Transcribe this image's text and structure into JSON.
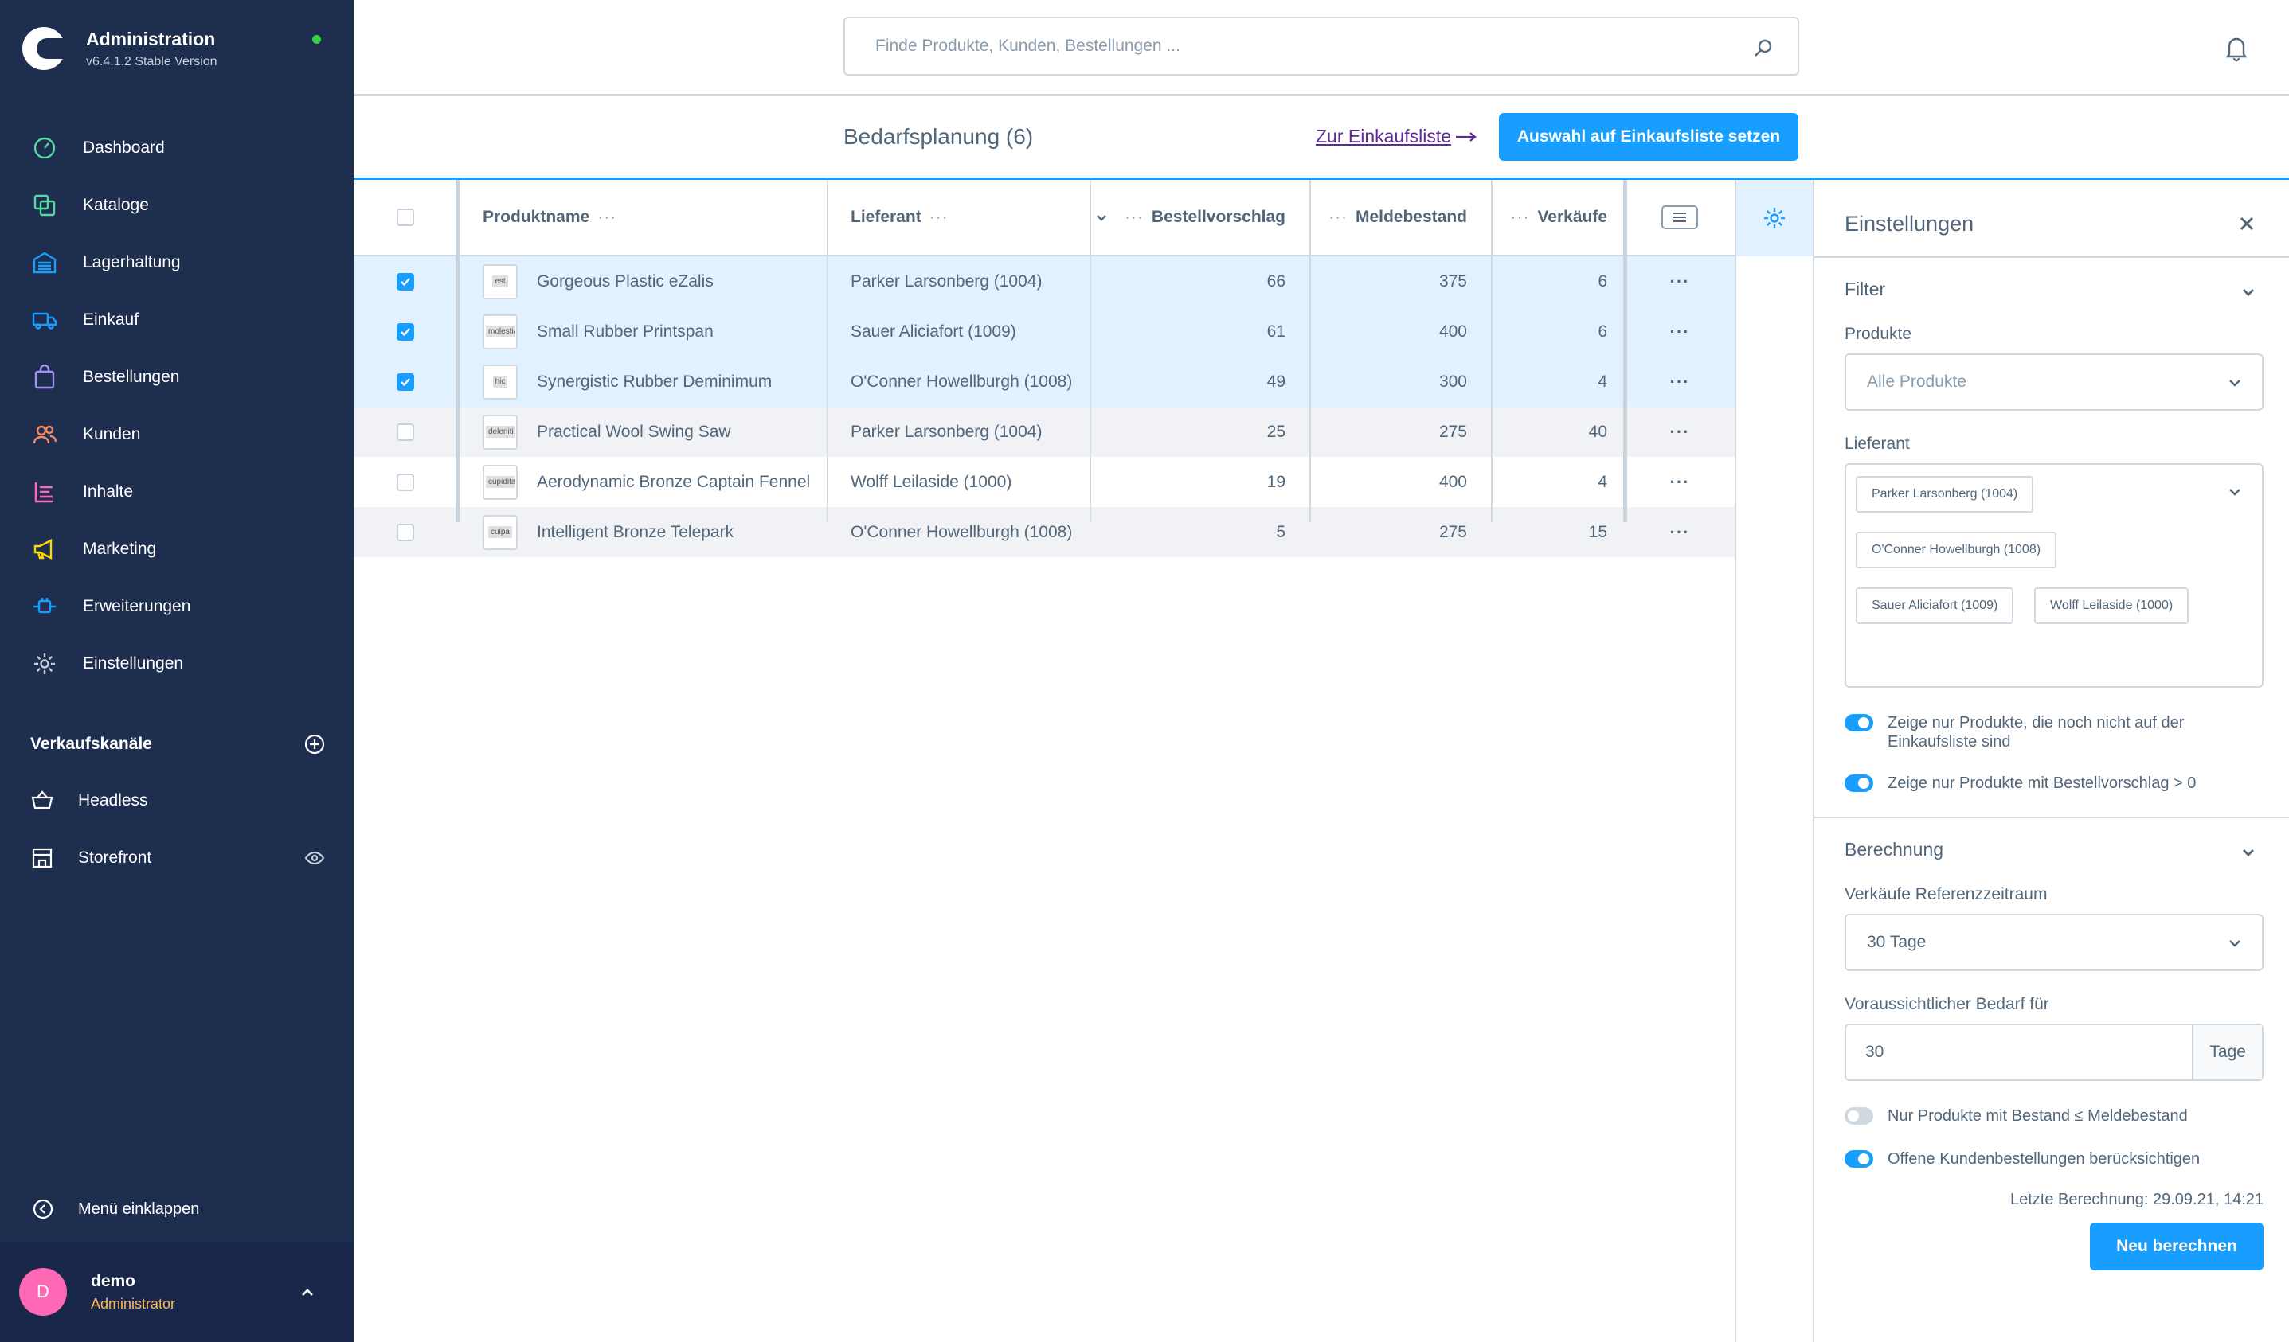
{
  "app": {
    "title": "Administration",
    "version": "v6.4.1.2 Stable Version"
  },
  "nav": [
    {
      "id": "dashboard",
      "label": "Dashboard",
      "icon": "dashboard-icon",
      "color": "#57d9a3"
    },
    {
      "id": "kataloge",
      "label": "Kataloge",
      "icon": "catalog-icon",
      "color": "#57d9a3"
    },
    {
      "id": "lagerhaltung",
      "label": "Lagerhaltung",
      "icon": "warehouse-icon",
      "color": "#189eff"
    },
    {
      "id": "einkauf",
      "label": "Einkauf",
      "icon": "truck-icon",
      "color": "#189eff"
    },
    {
      "id": "bestellungen",
      "label": "Bestellungen",
      "icon": "shopping-bag-icon",
      "color": "#a092f0"
    },
    {
      "id": "kunden",
      "label": "Kunden",
      "icon": "users-icon",
      "color": "#f88962"
    },
    {
      "id": "inhalte",
      "label": "Inhalte",
      "icon": "content-icon",
      "color": "#ff68b4"
    },
    {
      "id": "marketing",
      "label": "Marketing",
      "icon": "megaphone-icon",
      "color": "#ffd700"
    },
    {
      "id": "erweiterungen",
      "label": "Erweiterungen",
      "icon": "plug-icon",
      "color": "#189eff"
    },
    {
      "id": "einstellungen",
      "label": "Einstellungen",
      "icon": "gear-icon",
      "color": "#c8d0dc"
    }
  ],
  "sales_channels": {
    "title": "Verkaufskanäle",
    "items": [
      {
        "label": "Headless",
        "icon": "basket-icon"
      },
      {
        "label": "Storefront",
        "icon": "storefront-icon"
      }
    ]
  },
  "collapse_label": "Menü einklappen",
  "user": {
    "initial": "D",
    "name": "demo",
    "role": "Administrator"
  },
  "search": {
    "placeholder": "Finde Produkte, Kunden, Bestellungen ..."
  },
  "smartbar": {
    "title": "Bedarfsplanung (6)",
    "link_label": "Zur Einkaufsliste",
    "primary_button": "Auswahl auf Einkaufsliste setzen"
  },
  "grid": {
    "columns": {
      "name": "Produktname",
      "supplier": "Lieferant",
      "order": "Bestellvorschlag",
      "stock": "Meldebestand",
      "sales": "Verkäufe"
    },
    "rows": [
      {
        "thumb": "est",
        "name": "Gorgeous Plastic eZalis",
        "supplier": "Parker Larsonberg (1004)",
        "order": "66",
        "stock": "375",
        "sales": "6",
        "checked": true
      },
      {
        "thumb": "molestiae",
        "name": "Small Rubber Printspan",
        "supplier": "Sauer Aliciafort (1009)",
        "order": "61",
        "stock": "400",
        "sales": "6",
        "checked": true
      },
      {
        "thumb": "hic",
        "name": "Synergistic Rubber Deminimum",
        "supplier": "O'Conner Howellburgh (1008)",
        "order": "49",
        "stock": "300",
        "sales": "4",
        "checked": true
      },
      {
        "thumb": "deleniti",
        "name": "Practical Wool Swing Saw",
        "supplier": "Parker Larsonberg (1004)",
        "order": "25",
        "stock": "275",
        "sales": "40",
        "checked": false
      },
      {
        "thumb": "cupiditate",
        "name": "Aerodynamic Bronze Captain Fennel",
        "supplier": "Wolff Leilaside (1000)",
        "order": "19",
        "stock": "400",
        "sales": "4",
        "checked": false
      },
      {
        "thumb": "culpa",
        "name": "Intelligent Bronze Telepark",
        "supplier": "O'Conner Howellburgh (1008)",
        "order": "5",
        "stock": "275",
        "sales": "15",
        "checked": false
      }
    ]
  },
  "panel": {
    "title": "Einstellungen",
    "filter": {
      "title": "Filter",
      "products_label": "Produkte",
      "products_placeholder": "Alle Produkte",
      "supplier_label": "Lieferant",
      "supplier_tags": [
        "Parker Larsonberg (1004)",
        "O'Conner Howellburgh (1008)",
        "Sauer Aliciafort (1009)",
        "Wolff Leilaside (1000)"
      ],
      "toggle_not_in_list": "Zeige nur Produkte, die noch nicht auf der Einkaufsliste sind",
      "toggle_order_gt0": "Zeige nur Produkte mit Bestellvorschlag > 0"
    },
    "calc": {
      "title": "Berechnung",
      "period_label": "Verkäufe Referenzzeitraum",
      "period_value": "30 Tage",
      "demand_label": "Voraussichtlicher Bedarf für",
      "demand_value": "30",
      "demand_suffix": "Tage",
      "toggle_stock": "Nur Produkte mit Bestand ≤ Meldebestand",
      "toggle_open_orders": "Offene Kundenbestellungen berücksichtigen",
      "last_calc": "Letzte Berechnung: 29.09.21, 14:21",
      "button": "Neu berechnen"
    }
  }
}
